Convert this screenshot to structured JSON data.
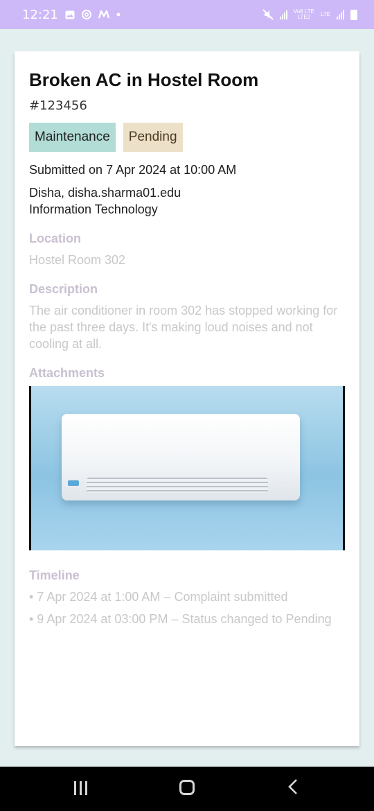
{
  "status_bar": {
    "time": "12:21",
    "icons": [
      "gallery-icon",
      "threads-icon",
      "m-app-icon",
      "dot-icon",
      "mute-icon",
      "signal-icon",
      "volte-icon",
      "lte-icon",
      "battery-icon"
    ],
    "volte_text": "Vo8 LTE",
    "lte_text": "LTE2",
    "lte_text2": "LTE"
  },
  "complaint": {
    "title": "Broken AC in Hostel Room",
    "id": "#123456",
    "category": "Maintenance",
    "status": "Pending",
    "submitted": "Submitted on 7 Apr 2024 at 10:00 AM",
    "submitter": "Disha, disha.sharma01.edu",
    "department": "Information Technology",
    "location_label": "Location",
    "location": "Hostel Room 302",
    "description_label": "Description",
    "description": "The air conditioner in room 302 has stopped working for the past three days. It's making loud noises and not cooling at all.",
    "attachments_label": "Attachments",
    "timeline_label": "Timeline",
    "timeline": [
      "• 7 Apr 2024 at 1:00 AM – Complaint submitted",
      "• 9 Apr 2024 at 03:00 PM – Status changed to Pending"
    ]
  },
  "colors": {
    "status_bar": "#cdb9f8",
    "page_bg": "#e3eeee",
    "maintenance_tag": "#b2dcd6",
    "pending_tag": "#ede0c8",
    "muted_label": "#c9c0d2",
    "muted_text": "#c8c8c8"
  },
  "nav_bar": {
    "icons": [
      "recent-apps-icon",
      "home-icon",
      "back-icon"
    ]
  }
}
